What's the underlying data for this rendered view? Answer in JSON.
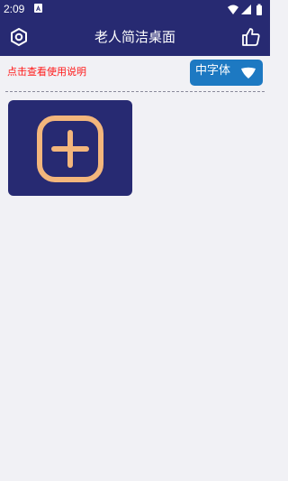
{
  "status_bar": {
    "time": "2:09",
    "icons": [
      "notification-icon",
      "wifi-icon",
      "signal-icon",
      "battery-icon"
    ]
  },
  "app_bar": {
    "title": "老人简洁桌面",
    "left_icon": "settings-icon",
    "right_icon": "thumbs-up-icon"
  },
  "toolbar": {
    "help_link": "点击查看使用说明",
    "font_size_button": "中字体"
  },
  "tiles": [
    {
      "name": "add-app-tile",
      "icon": "plus-square-icon"
    }
  ],
  "colors": {
    "primary": "#272a72",
    "background": "#f1f1f5",
    "accent_blue": "#1d79c2",
    "link_red": "#ff1a1a",
    "icon_peach": "#f3b67c"
  }
}
